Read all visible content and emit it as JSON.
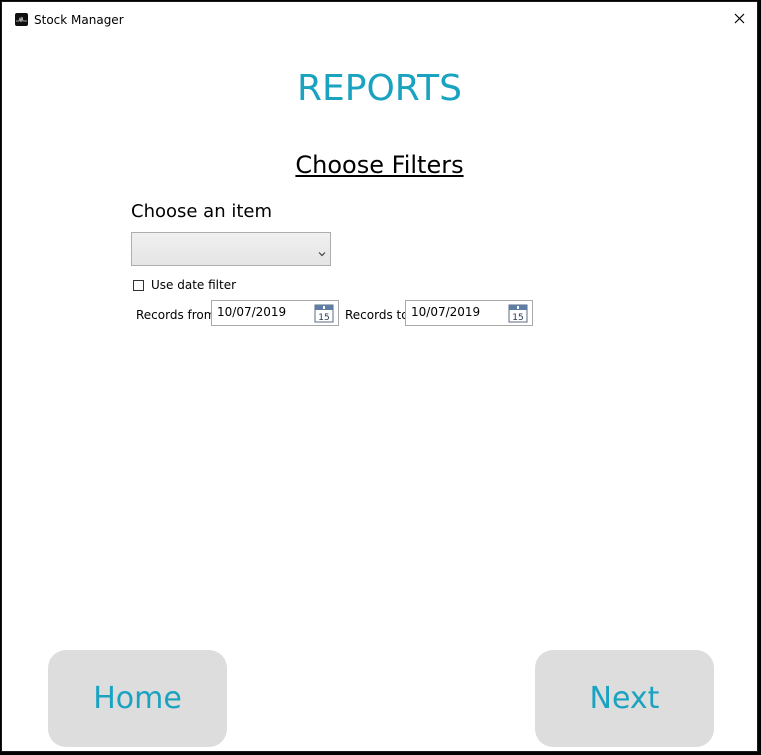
{
  "window": {
    "title": "Stock Manager",
    "close_icon": "close-icon"
  },
  "colors": {
    "accent": "#1aa3c0",
    "button_bg": "#dddddd"
  },
  "page": {
    "heading": "REPORTS",
    "subheading": "Choose Filters"
  },
  "item_filter": {
    "label": "Choose an item",
    "selected_value": ""
  },
  "date_filter": {
    "checkbox_label": "Use date filter",
    "checked": false,
    "from_label": "Records from",
    "from_value": "10/07/2019",
    "to_label": "Records to",
    "to_value": "10/07/2019",
    "calendar_day": "15"
  },
  "buttons": {
    "home": "Home",
    "next": "Next"
  }
}
